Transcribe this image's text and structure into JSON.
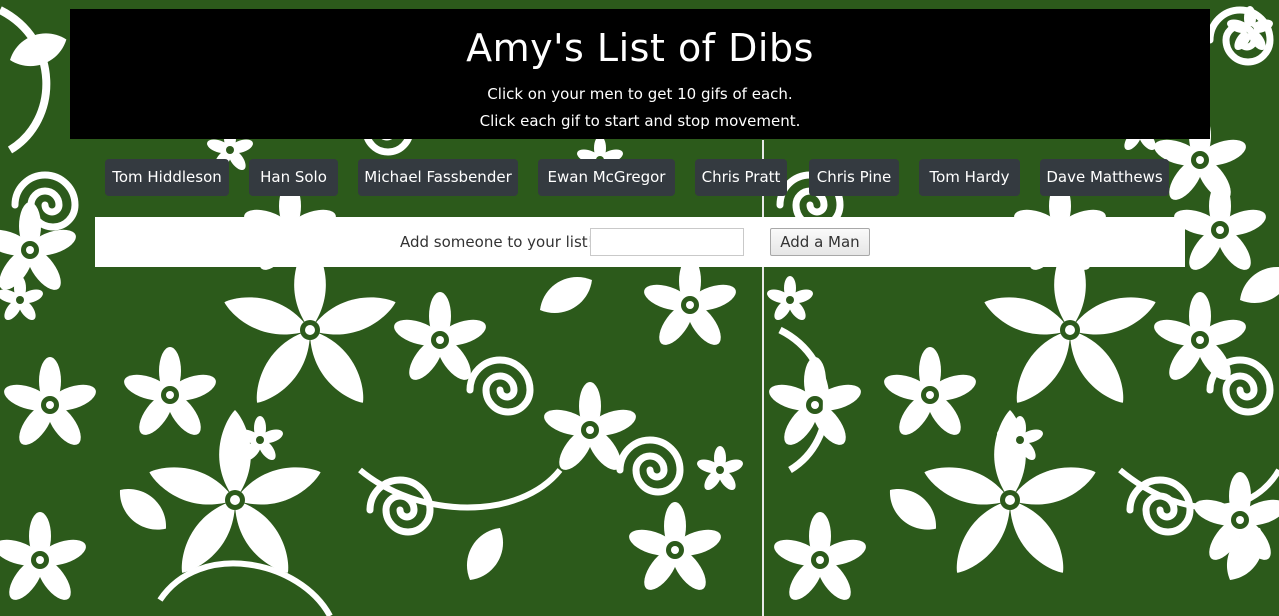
{
  "header": {
    "title": "Amy's List of Dibs",
    "subtitle_line1": "Click on your men to get 10 gifs of each.",
    "subtitle_line2": "Click each gif to start and stop movement."
  },
  "men": [
    "Tom Hiddleson",
    "Han Solo",
    "Michael Fassbender",
    "Ewan McGregor",
    "Chris Pratt",
    "Chris Pine",
    "Tom Hardy",
    "Dave Matthews"
  ],
  "add_form": {
    "label": "Add someone to your list!",
    "input_value": "",
    "button_label": "Add a Man"
  },
  "colors": {
    "background_green": "#2c5a1b",
    "header_bg": "#000000",
    "button_bg": "#343a40",
    "pattern": "#ffffff"
  },
  "icons": {
    "background": "floral-pattern"
  }
}
